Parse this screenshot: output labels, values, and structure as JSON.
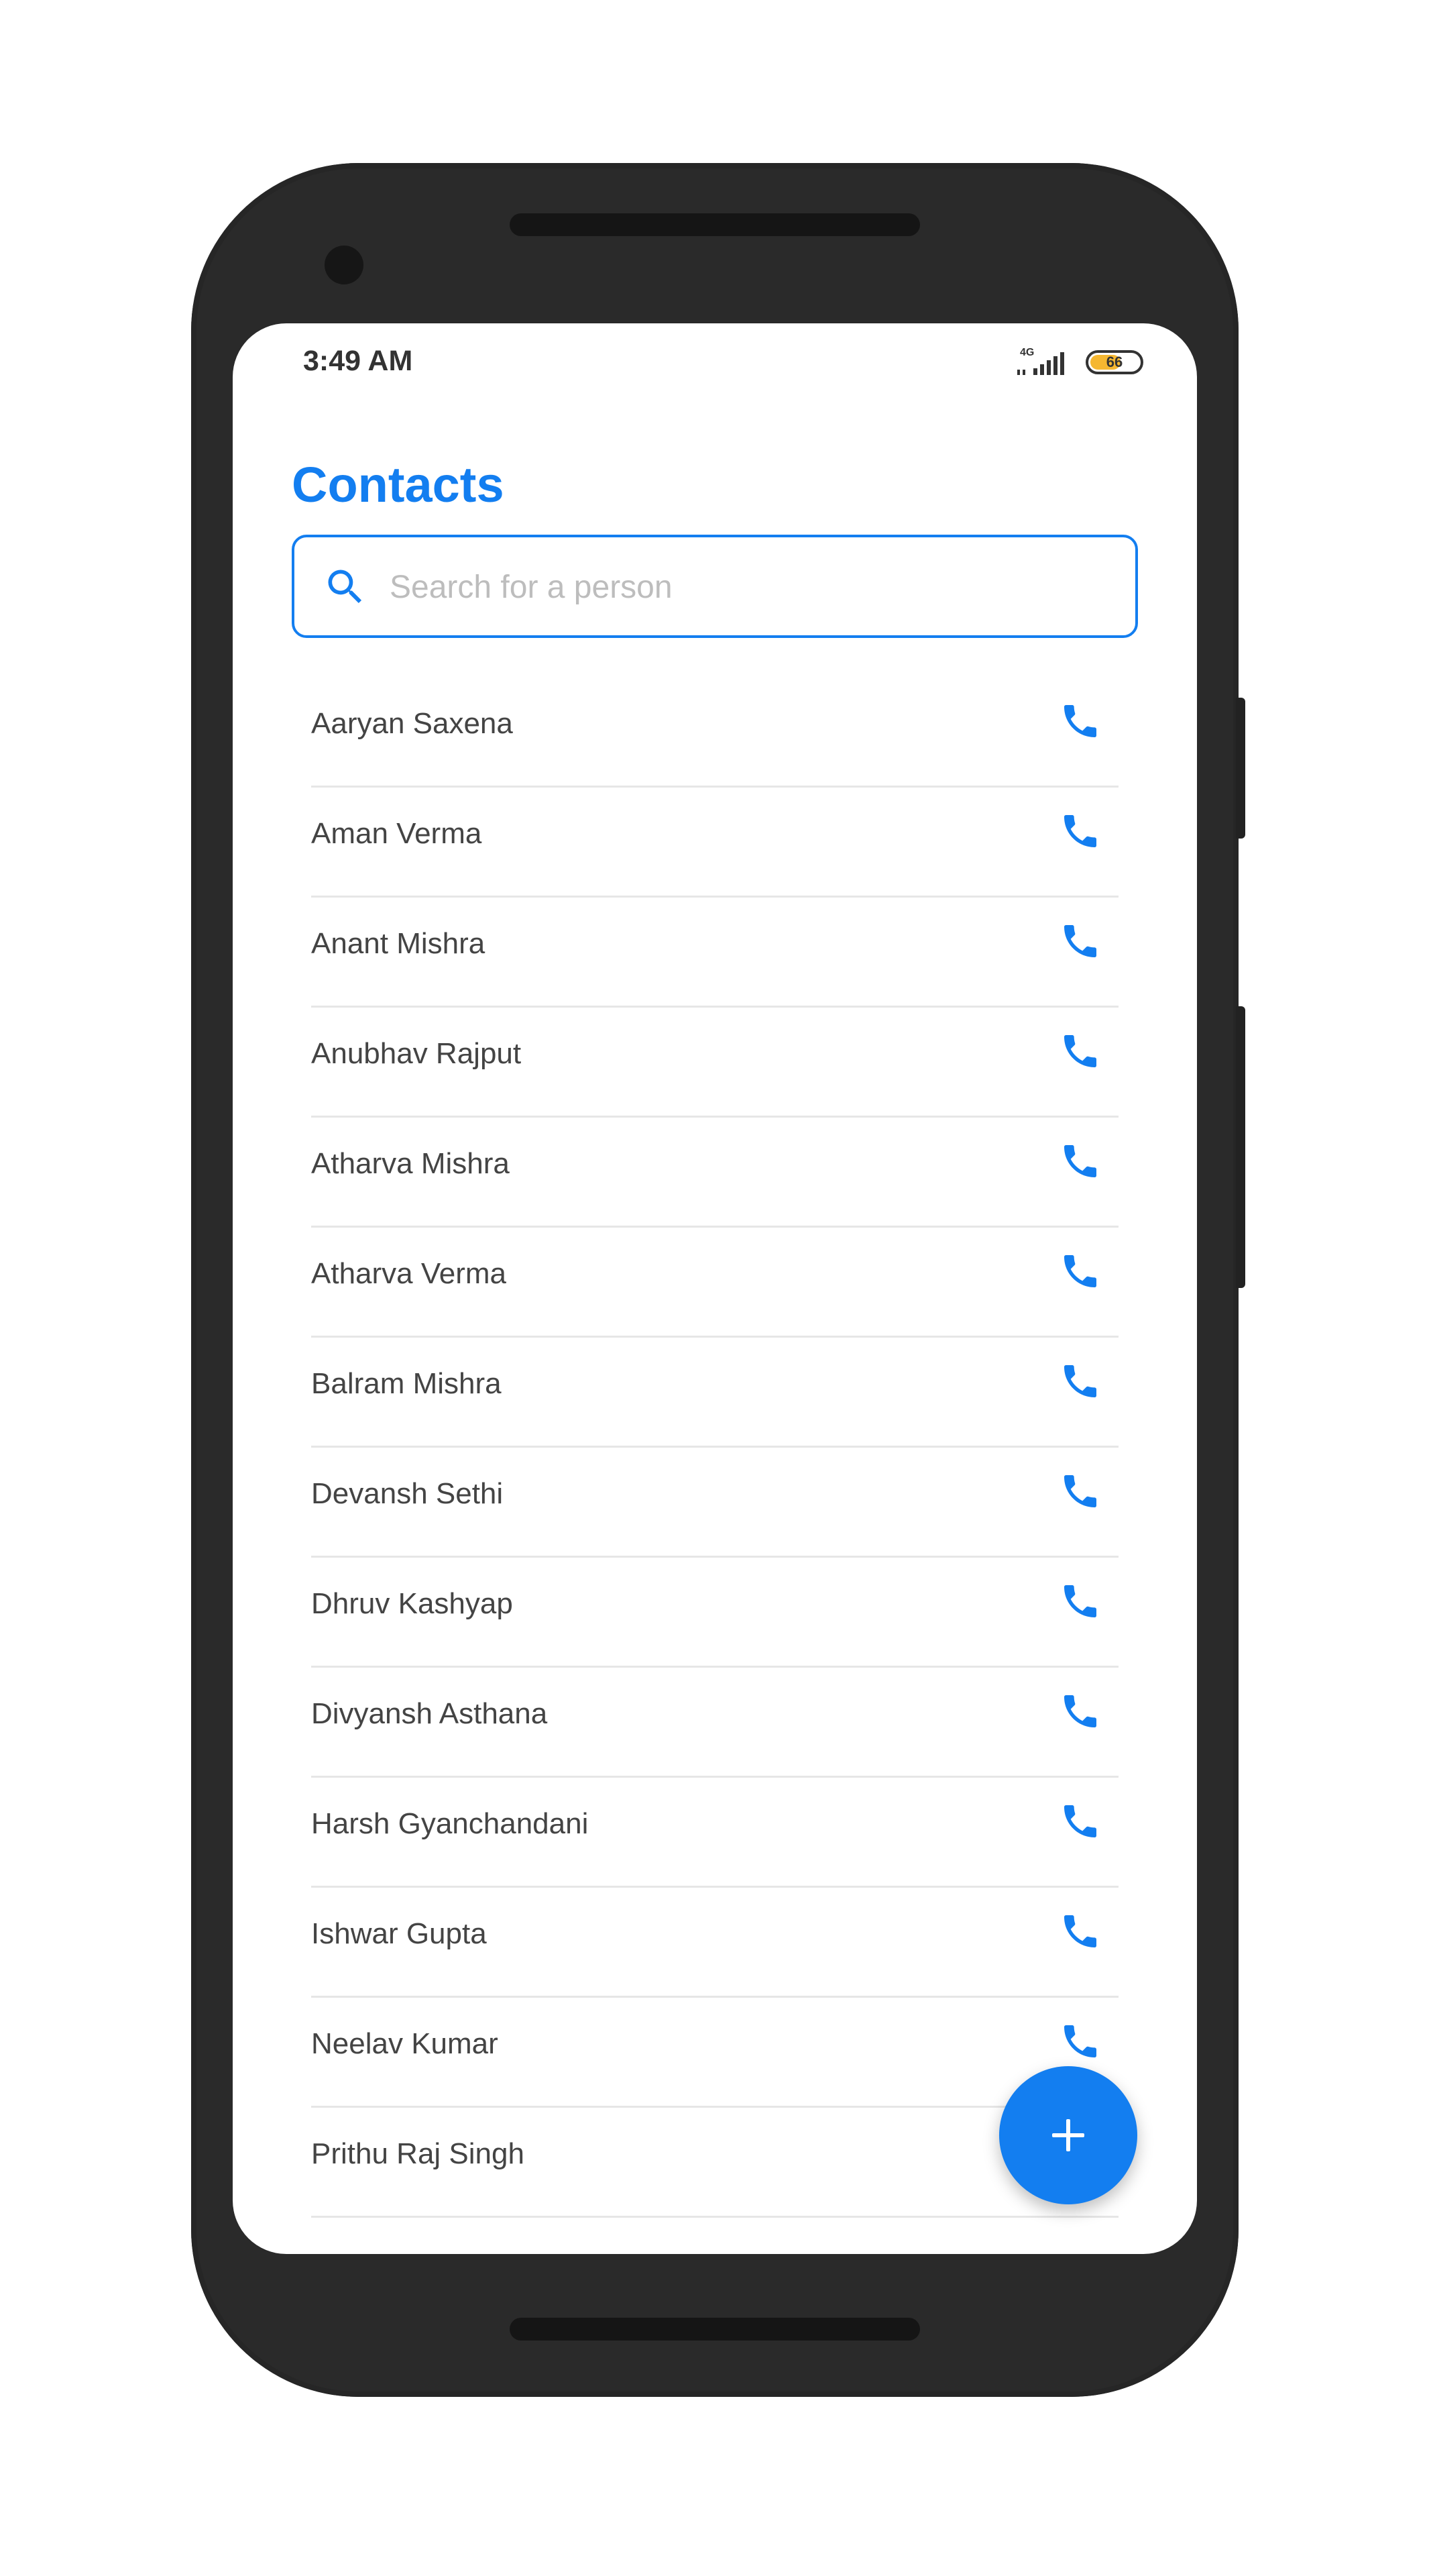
{
  "status_bar": {
    "time": "3:49 AM",
    "network_type": "4G",
    "battery_level": "66",
    "battery_fraction": 0.66
  },
  "header": {
    "title": "Contacts"
  },
  "search": {
    "placeholder": "Search for a person",
    "value": ""
  },
  "contacts": [
    {
      "name": "Aaryan Saxena"
    },
    {
      "name": "Aman Verma"
    },
    {
      "name": "Anant Mishra"
    },
    {
      "name": "Anubhav Rajput"
    },
    {
      "name": "Atharva Mishra"
    },
    {
      "name": "Atharva Verma"
    },
    {
      "name": "Balram Mishra"
    },
    {
      "name": "Devansh Sethi"
    },
    {
      "name": "Dhruv Kashyap"
    },
    {
      "name": "Divyansh Asthana"
    },
    {
      "name": "Harsh Gyanchandani"
    },
    {
      "name": "Ishwar Gupta"
    },
    {
      "name": "Neelav Kumar"
    },
    {
      "name": "Prithu Raj Singh"
    }
  ],
  "icons": {
    "search": "search-icon",
    "call": "phone-icon",
    "add": "plus-icon"
  },
  "colors": {
    "accent": "#137ef0",
    "battery": "#f5b731",
    "text_primary": "#444444",
    "placeholder": "#bdbdbd"
  }
}
